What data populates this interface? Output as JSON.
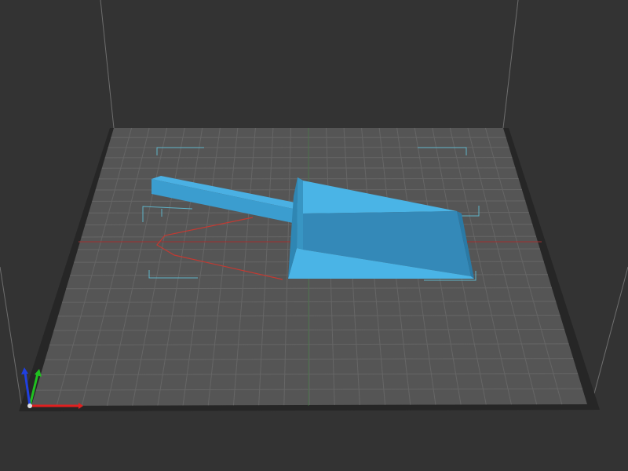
{
  "viewport": {
    "background": "#333333",
    "bed_color": "#585858",
    "bed_edge_color": "#222222",
    "grid_color": "#6a6a6a",
    "volume_edge_color": "#7a7a7a",
    "bounding_box_color": "#5fb3c8",
    "model_color": "#4ab0e3",
    "model_side_color": "#3a98c8",
    "model_shadow_color": "#2e82ad",
    "projection_color": "#c23a32"
  },
  "model": {
    "name": "scoop",
    "selected": true
  },
  "axes": {
    "x": {
      "color": "#e02020",
      "icon": "axis-x-arrow"
    },
    "y": {
      "color": "#20c020",
      "icon": "axis-y-arrow"
    },
    "z": {
      "color": "#2040e0",
      "icon": "axis-z-arrow"
    }
  }
}
